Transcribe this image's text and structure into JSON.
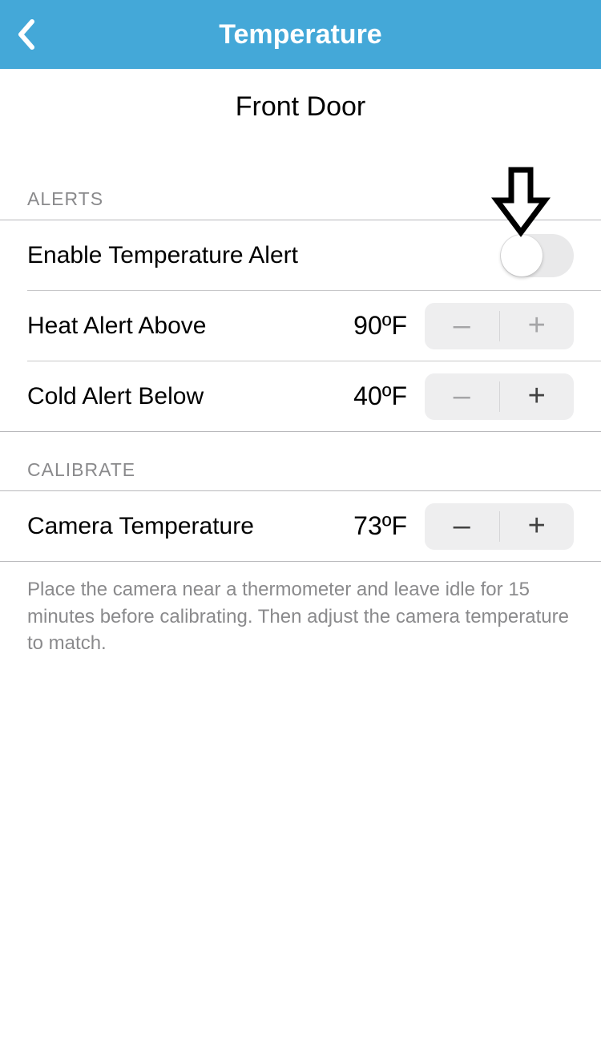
{
  "header": {
    "title": "Temperature"
  },
  "device_name": "Front Door",
  "sections": {
    "alerts": {
      "header": "ALERTS",
      "enable": {
        "label": "Enable Temperature Alert",
        "on": false
      },
      "heat": {
        "label": "Heat Alert Above",
        "value": "90",
        "unit": "ºF"
      },
      "cold": {
        "label": "Cold Alert Below",
        "value": "40",
        "unit": "ºF"
      }
    },
    "calibrate": {
      "header": "CALIBRATE",
      "camera_temp": {
        "label": "Camera Temperature",
        "value": "73",
        "unit": "ºF"
      },
      "footnote": "Place the camera near a thermometer and leave idle for 15 minutes before calibrating. Then adjust the camera temperature to match."
    }
  },
  "glyphs": {
    "minus": "–",
    "plus": "+"
  }
}
